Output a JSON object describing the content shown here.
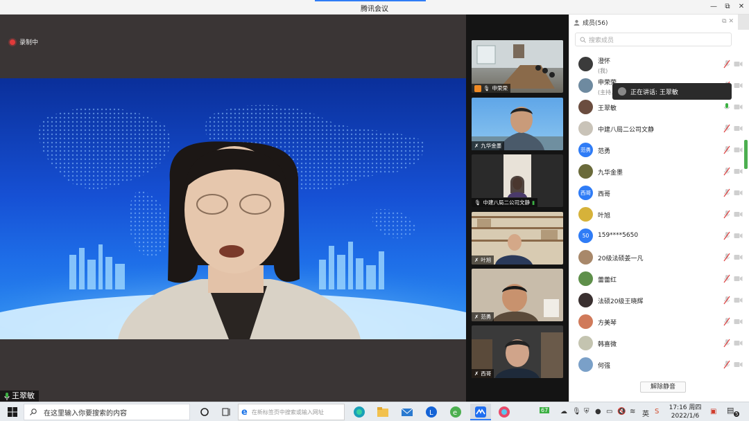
{
  "window": {
    "title": "腾讯会议",
    "minimize": "—",
    "maximize": "⧉",
    "close": "✕"
  },
  "recording": {
    "label": "录制中"
  },
  "speaker": {
    "name": "王翠敏"
  },
  "thumbnails": [
    {
      "name": "申荣荣",
      "host": true
    },
    {
      "name": "九华金墨",
      "host": false
    },
    {
      "name": "中建八局二公司文静",
      "host": false
    },
    {
      "name": "叶旭",
      "host": false
    },
    {
      "name": "范勇",
      "host": false
    },
    {
      "name": "西哥",
      "host": false
    }
  ],
  "panel": {
    "header": "成员(56)",
    "search_placeholder": "搜索成员",
    "tooltip": "正在讲话: 王翠敏",
    "unmute_button": "解除静音",
    "members": [
      {
        "name": "澄怀",
        "sub": "(我)",
        "avatar": "photo",
        "color": "#3b3b3b"
      },
      {
        "name": "申荣荣",
        "sub": "(主持人",
        "avatar": "photo",
        "color": "#6e8aa0"
      },
      {
        "name": "王翠敏",
        "sub": "",
        "avatar": "photo",
        "color": "#6b4d3f",
        "speaking": true
      },
      {
        "name": "中建八局二公司文静",
        "sub": "",
        "avatar": "photo",
        "color": "#c9c3b8"
      },
      {
        "name": "范勇",
        "sub": "",
        "avatar": "text",
        "initials": "范勇",
        "color": "#2f7cf6"
      },
      {
        "name": "九华金墨",
        "sub": "",
        "avatar": "photo",
        "color": "#6a6a3a"
      },
      {
        "name": "西哥",
        "sub": "",
        "avatar": "text",
        "initials": "西哥",
        "color": "#2f7cf6"
      },
      {
        "name": "叶旭",
        "sub": "",
        "avatar": "photo",
        "color": "#d6b23a"
      },
      {
        "name": "159****5650",
        "sub": "",
        "avatar": "text",
        "initials": "50",
        "color": "#2f7cf6"
      },
      {
        "name": "20级法硕姜一凡",
        "sub": "",
        "avatar": "photo",
        "color": "#a8886a"
      },
      {
        "name": "蕾蕾红",
        "sub": "",
        "avatar": "photo",
        "color": "#5e8f4a"
      },
      {
        "name": "法硕20级王晓辉",
        "sub": "",
        "avatar": "photo",
        "color": "#3a3030"
      },
      {
        "name": "方美琴",
        "sub": "",
        "avatar": "photo",
        "color": "#d07a5a"
      },
      {
        "name": "韩喜微",
        "sub": "",
        "avatar": "photo",
        "color": "#c4c4b0"
      },
      {
        "name": "何强",
        "sub": "",
        "avatar": "photo",
        "color": "#7aa0c8"
      }
    ]
  },
  "taskbar": {
    "search_placeholder": "在这里输入你要搜索的内容",
    "browser_url_placeholder": "在新标签页中搜索或输入网址",
    "battery": "67",
    "ime": "英",
    "time": "17:16 周四",
    "date": "2022/1/6",
    "notification_count": "5"
  },
  "colors": {
    "accent": "#2f7cf6",
    "strip_bg": "#141414",
    "main_bg": "#3a3535",
    "mute_red": "#e04848",
    "speaking_green": "#3cb043"
  }
}
